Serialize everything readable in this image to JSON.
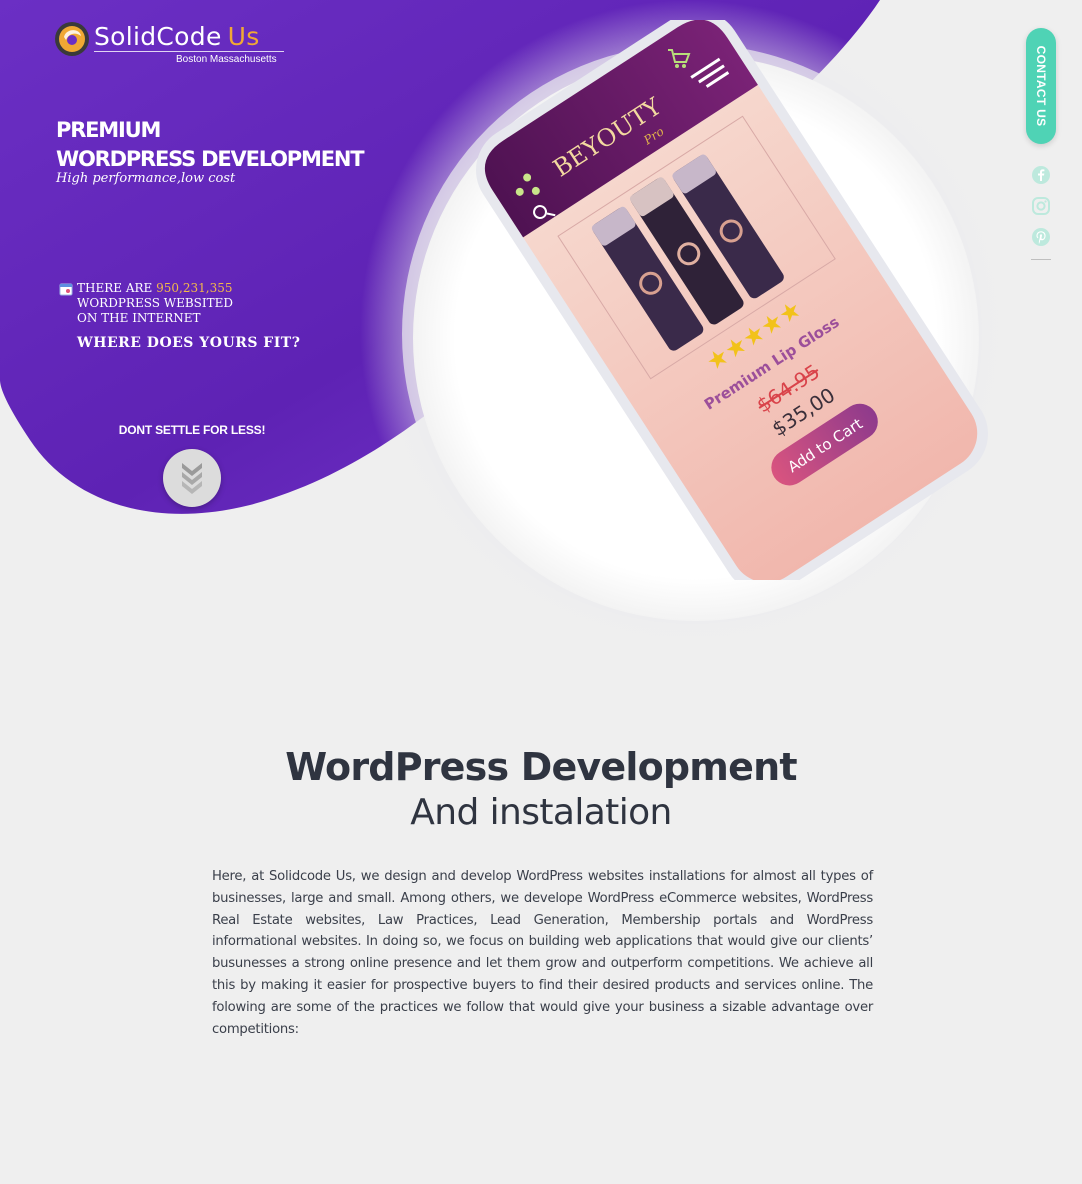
{
  "brand": {
    "name": "SolidCode",
    "name_accent": "Us",
    "location": "Boston Massachusetts"
  },
  "hero": {
    "title_line1": "PREMIUM",
    "title_line2": "WORDPRESS DEVELOPMENT",
    "tagline": "High performance,low cost",
    "stat_prefix": "THERE ARE",
    "stat_number": "950,231,355",
    "stat_line2": "WORDPRESS WEBSITED",
    "stat_line3": "ON THE INTERNET",
    "question": "WHERE DOES YOURS FIT?",
    "settle": "DONT SETTLE FOR LESS!"
  },
  "phone_mockup": {
    "app_logo": "BEYOUTY",
    "app_logo_sub": "Pro",
    "rating_stars": 5,
    "product_name": "Premium Lip Gloss",
    "old_price": "$64.95",
    "new_price": "$35,00",
    "cta": "Add to Cart"
  },
  "sidebar": {
    "contact_label": "CONTACT US",
    "social": [
      "facebook-icon",
      "instagram-icon",
      "pinterest-icon"
    ]
  },
  "section": {
    "title": "WordPress Development",
    "subtitle": "And instalation",
    "body": "Here, at Solidcode Us, we design and develop WordPress websites installations for almost all types of businesses, large and small. Among others, we develope WordPress eCommerce websites, WordPress Real Estate websites, Law Practices, Lead Generation, Membership portals and WordPress informational websites. In doing so, we focus on building web applications that would give our clients’ busunesses a strong online presence and let them grow and outperform competitions. We achieve all this by making it easier for prospective buyers to find their desired products and services online. The folowing are some of the practices we follow that would give your business a sizable advantage over competitions:"
  },
  "colors": {
    "hero_purple": "#6a2bc0",
    "accent_teal": "#4fd3b5",
    "logo_accent": "#f0a834",
    "stat_number": "#f3b94a",
    "cta_pink": "#d9547f"
  }
}
